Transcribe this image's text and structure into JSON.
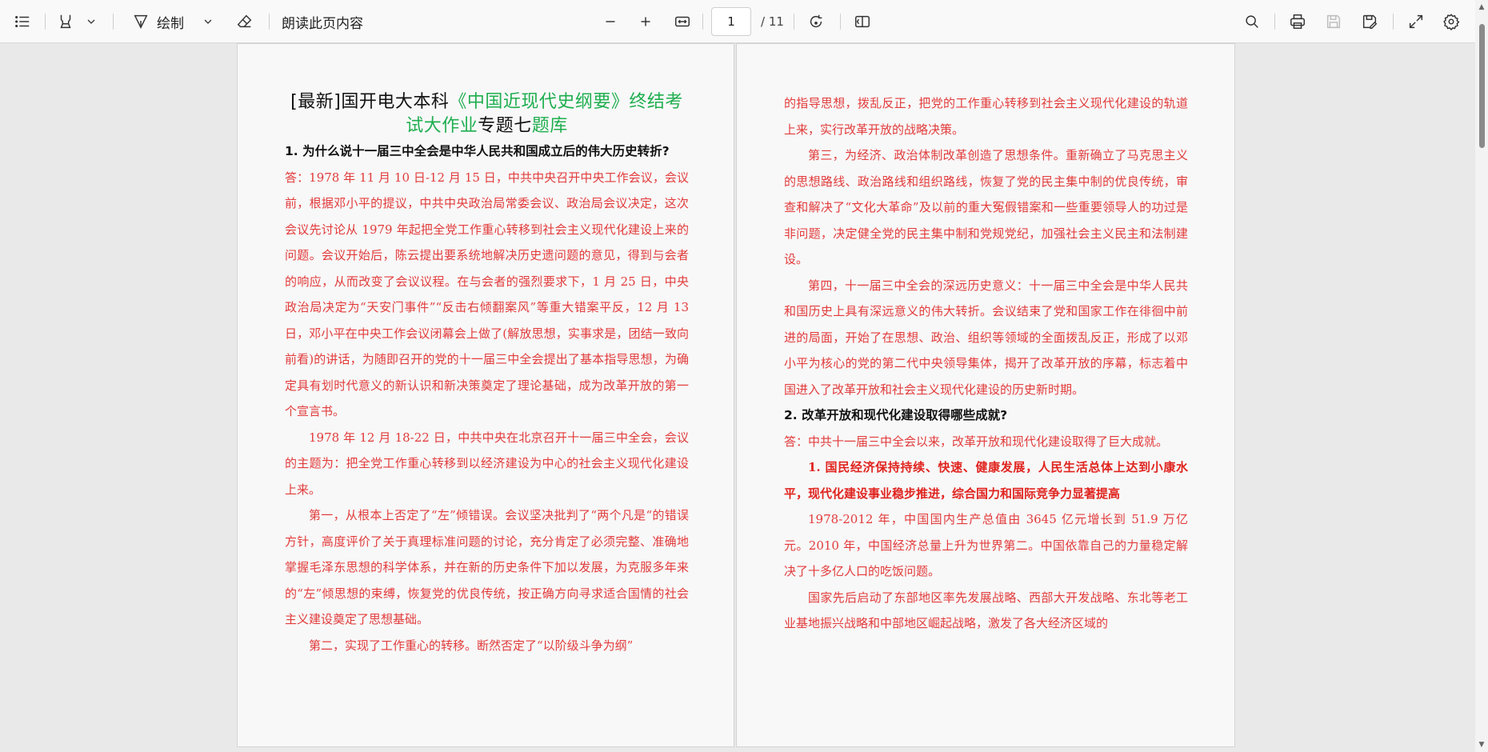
{
  "toolbar": {
    "draw_label": "绘制",
    "read_aloud_label": "朗读此页内容",
    "page_current": "1",
    "page_total": "/ 11"
  },
  "pages": {
    "left": {
      "title_prefix": "[最新]国开电大本科",
      "title_green1": "《中国近现代史纲要》终结考试大作业",
      "title_mid": "专题七",
      "title_green2": "题库",
      "question1": "1. 为什么说十一届三中全会是中华人民共和国成立后的伟大历史转折?",
      "paragraphs": [
        "答：1978 年 11 月 10 日-12 月 15 日，中共中央召开中央工作会议，会议前，根据邓小平的提议，中共中央政治局常委会议、政治局会议决定，这次会议先讨论从 1979 年起把全党工作重心转移到社会主义现代化建设上来的问题。会议开始后，陈云提出要系统地解决历史遗问题的意见，得到与会者的响应，从而改变了会议议程。在与会者的强烈要求下，1 月 25 日，中央政治局决定为“天安门事件”“反击右倾翻案风”等重大错案平反，12 月 13 日，邓小平在中央工作会议闭幕会上做了(解放思想，实事求是，团结一致向前看)的讲话，为随即召开的党的十一届三中全会提出了基本指导思想，为确定具有划时代意义的新认识和新决策奠定了理论基础，成为改革开放的第一个宣言书。",
        "1978 年 12 月 18-22 日，中共中央在北京召开十一届三中全会，会议的主题为：把全党工作重心转移到以经济建设为中心的社会主义现代化建设上来。",
        "第一，从根本上否定了“左”倾错误。会议坚决批判了“两个凡是“的错误方针，高度评价了关于真理标准问题的讨论，充分肯定了必须完整、准确地掌握毛泽东思想的科学体系，并在新的历史条件下加以发展，为克服多年来的“左”倾思想的束缚，恢复党的优良传统，按正确方向寻求适合国情的社会主义建设奠定了思想基础。",
        "第二，实现了工作重心的转移。断然否定了“以阶级斗争为纲”"
      ]
    },
    "right": {
      "paragraphs_a": [
        "的指导思想，拨乱反正，把党的工作重心转移到社会主义现代化建设的轨道上来，实行改革开放的战略决策。",
        "第三，为经济、政治体制改革创造了思想条件。重新确立了马克思主义的思想路线、政治路线和组织路线，恢复了党的民主集中制的优良传统，审查和解决了“文化大革命”及以前的重大冤假错案和一些重要领导人的功过是非问题，决定健全党的民主集中制和党规党纪，加强社会主义民主和法制建设。",
        "第四，十一届三中全会的深远历史意义：十一届三中全会是中华人民共和国历史上具有深远意义的伟大转折。会议结束了党和国家工作在徘徊中前进的局面，开始了在思想、政治、组织等领域的全面拨乱反正，形成了以邓小平为核心的党的第二代中央领导集体，揭开了改革开放的序幕，标志着中国进入了改革开放和社会主义现代化建设的历史新时期。"
      ],
      "question2": "2. 改革开放和现代化建设取得哪些成就?",
      "answer2": "答：中共十一届三中全会以来，改革开放和现代化建设取得了巨大成就。",
      "bold_heading": "1. 国民经济保持持续、快速、健康发展，人民生活总体上达到小康水平，现代化建设事业稳步推进，综合国力和国际竞争力显著提高",
      "paragraphs_b": [
        "1978-2012 年，中国国内生产总值由 3645 亿元增长到 51.9 万亿元。2010 年，中国经济总量上升为世界第二。中国依靠自己的力量稳定解决了十多亿人口的吃饭问题。",
        "国家先后启动了东部地区率先发展战略、西部大开发战略、东北等老工业基地振兴战略和中部地区崛起战略，激发了各大经济区域的"
      ]
    }
  }
}
